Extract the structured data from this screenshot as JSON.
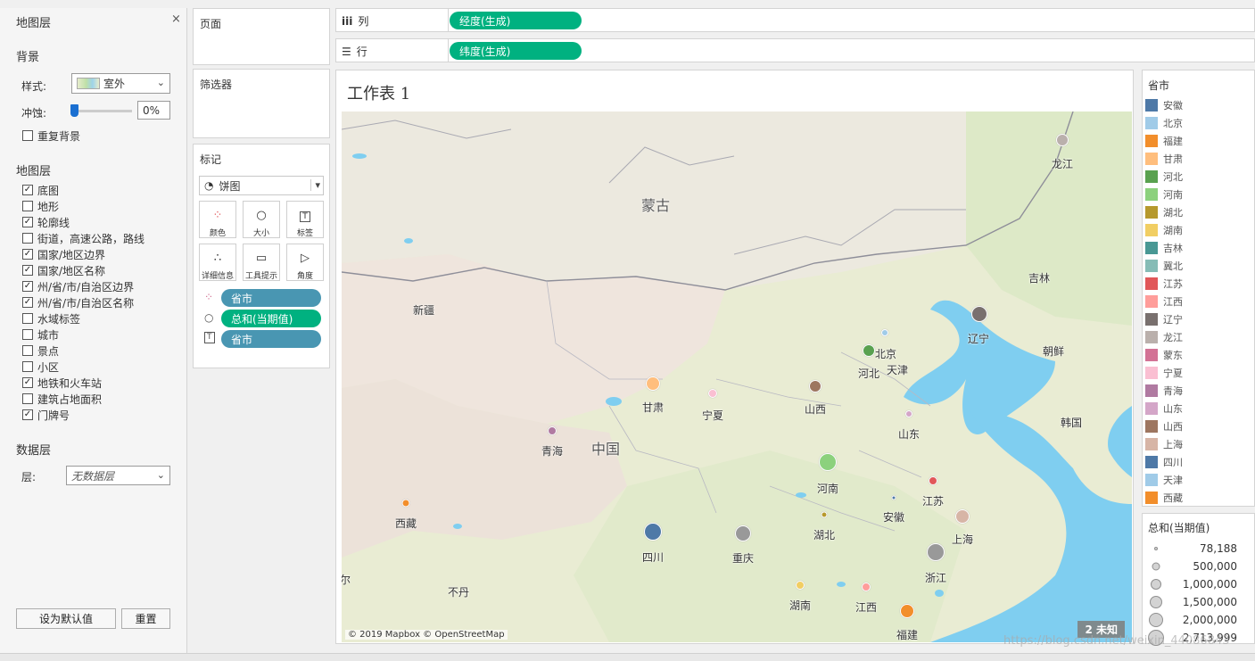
{
  "left_panel": {
    "title": "地图层",
    "background_section": "背景",
    "style_label": "样式:",
    "style_value": "室外",
    "wash_label": "冲蚀:",
    "wash_value": "0%",
    "repeat_background": "重复背景",
    "map_layers_section": "地图层",
    "layers": [
      {
        "label": "底图",
        "checked": true
      },
      {
        "label": "地形",
        "checked": false
      },
      {
        "label": "轮廓线",
        "checked": true
      },
      {
        "label": "街道，高速公路，路线",
        "checked": false
      },
      {
        "label": "国家/地区边界",
        "checked": true
      },
      {
        "label": "国家/地区名称",
        "checked": true
      },
      {
        "label": "州/省/市/自治区边界",
        "checked": true
      },
      {
        "label": "州/省/市/自治区名称",
        "checked": true
      },
      {
        "label": "水域标签",
        "checked": false
      },
      {
        "label": "城市",
        "checked": false
      },
      {
        "label": "景点",
        "checked": false
      },
      {
        "label": "小区",
        "checked": false
      },
      {
        "label": "地铁和火车站",
        "checked": true
      },
      {
        "label": "建筑占地面积",
        "checked": false
      },
      {
        "label": "门牌号",
        "checked": true
      }
    ],
    "data_layer_section": "数据层",
    "layer_label": "层:",
    "layer_value": "无数据层",
    "set_default_button": "设为默认值",
    "reset_button": "重置"
  },
  "middle": {
    "pages": "页面",
    "filters": "筛选器",
    "marks": "标记",
    "mark_type": "饼图",
    "mark_buttons": [
      "颜色",
      "大小",
      "标签",
      "详细信息",
      "工具提示",
      "角度"
    ],
    "mark_pills": [
      "省市",
      "总和(当期值)",
      "省市"
    ]
  },
  "shelves": {
    "columns_label": "列",
    "columns_pill": "经度(生成)",
    "rows_label": "行",
    "rows_pill": "纬度(生成)"
  },
  "sheet": {
    "title": "工作表 1",
    "copyright": "© 2019 Mapbox © OpenStreetMap",
    "unknown_badge": "2 未知"
  },
  "map_places": [
    "蒙古",
    "中国",
    "新疆",
    "朝鲜",
    "韩国",
    "不丹",
    "泊尔",
    "吉林",
    "龙江",
    "辽宁",
    "北京",
    "天津",
    "河北",
    "甘肃",
    "宁夏",
    "山西",
    "山东",
    "青海",
    "河南",
    "江苏",
    "安徽",
    "西藏",
    "湖北",
    "上海",
    "四川",
    "重庆",
    "浙江",
    "湖南",
    "江西",
    "福建"
  ],
  "legend_color": {
    "title": "省市",
    "items": [
      {
        "label": "安徽",
        "color": "#4e79a7"
      },
      {
        "label": "北京",
        "color": "#a0cbe8"
      },
      {
        "label": "福建",
        "color": "#f28e2b"
      },
      {
        "label": "甘肃",
        "color": "#ffbe7d"
      },
      {
        "label": "河北",
        "color": "#59a14f"
      },
      {
        "label": "河南",
        "color": "#8cd17d"
      },
      {
        "label": "湖北",
        "color": "#b6992d"
      },
      {
        "label": "湖南",
        "color": "#f1ce63"
      },
      {
        "label": "吉林",
        "color": "#499894"
      },
      {
        "label": "冀北",
        "color": "#86bcb6"
      },
      {
        "label": "江苏",
        "color": "#e15759"
      },
      {
        "label": "江西",
        "color": "#ff9d9a"
      },
      {
        "label": "辽宁",
        "color": "#79706e"
      },
      {
        "label": "龙江",
        "color": "#bab0ac"
      },
      {
        "label": "蒙东",
        "color": "#d37295"
      },
      {
        "label": "宁夏",
        "color": "#fabfd2"
      },
      {
        "label": "青海",
        "color": "#b07aa1"
      },
      {
        "label": "山东",
        "color": "#d4a6c8"
      },
      {
        "label": "山西",
        "color": "#9d7660"
      },
      {
        "label": "上海",
        "color": "#d7b5a6"
      },
      {
        "label": "四川",
        "color": "#4e79a7"
      },
      {
        "label": "天津",
        "color": "#a0cbe8"
      },
      {
        "label": "西藏",
        "color": "#f28e2b"
      }
    ]
  },
  "legend_size": {
    "title": "总和(当期值)",
    "items": [
      "78,188",
      "500,000",
      "1,000,000",
      "1,500,000",
      "2,000,000",
      "2,713,999"
    ]
  },
  "watermark": "https://blog.csdn.net/weixin_44086843"
}
